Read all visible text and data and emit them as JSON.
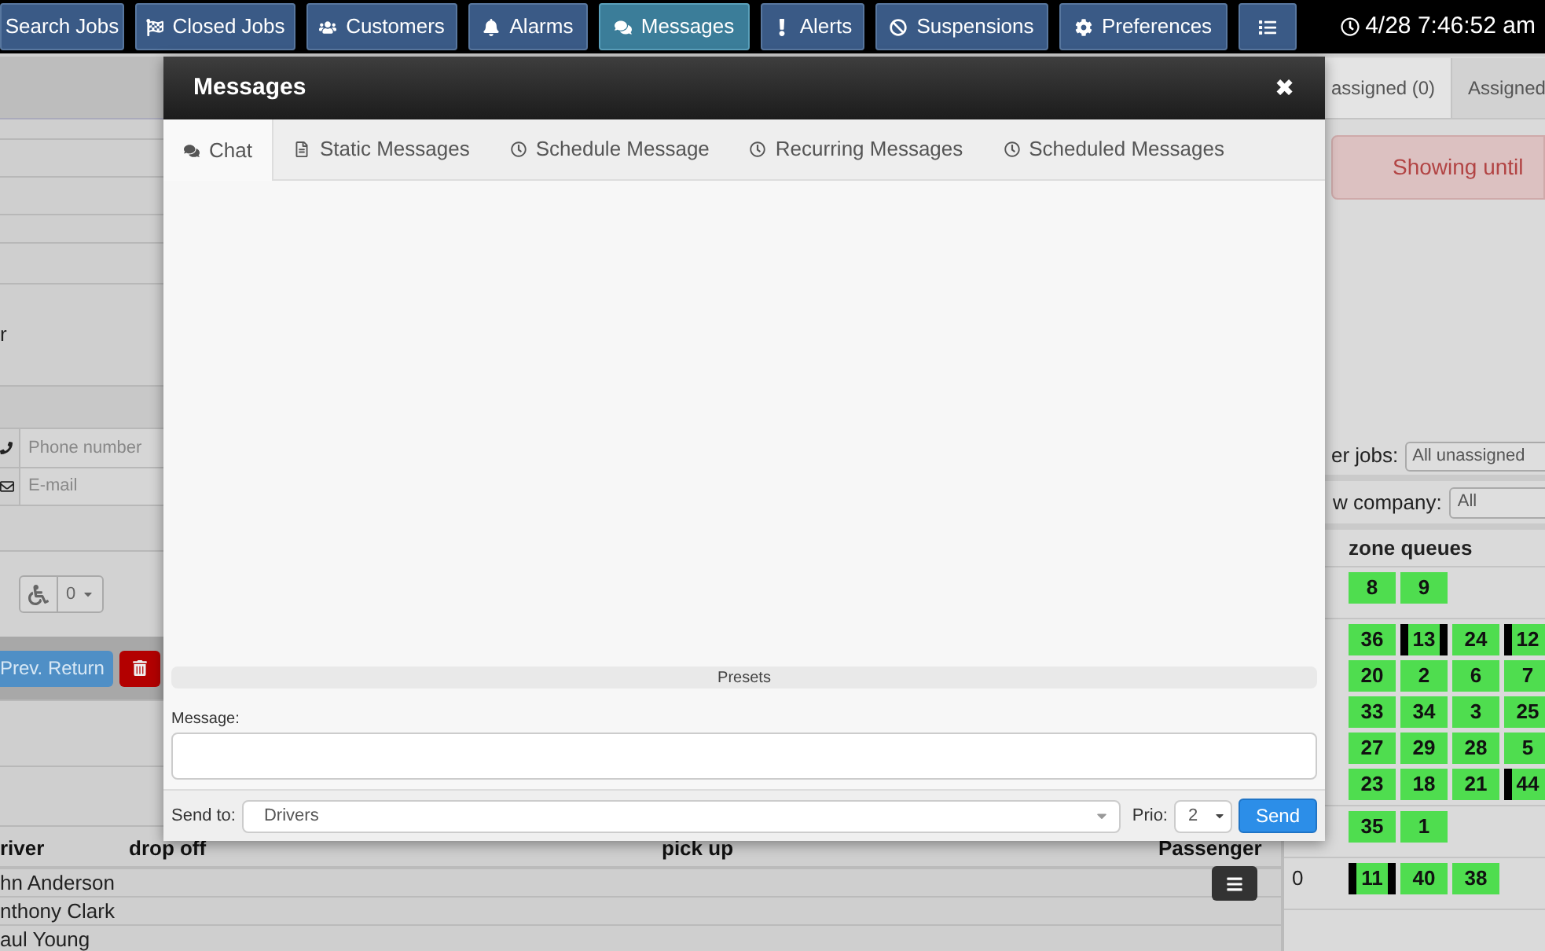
{
  "nav": [
    {
      "label": "Search Jobs",
      "selected": false
    },
    {
      "label": "Closed Jobs",
      "selected": false
    },
    {
      "label": "Customers",
      "selected": false
    },
    {
      "label": "Alarms",
      "selected": false
    },
    {
      "label": "Messages",
      "selected": true
    },
    {
      "label": "Alerts",
      "selected": false
    },
    {
      "label": "Suspensions",
      "selected": false
    },
    {
      "label": "Preferences",
      "selected": false
    },
    {
      "selected": false
    }
  ],
  "clock": "4/28 7:46:52 am",
  "left": {
    "visible_text": "r",
    "phone_placeholder": "Phone number",
    "email_placeholder": "E-mail",
    "wheelchair_value": "0",
    "prev_return": "Prev. Return",
    "table": {
      "columns": [
        "river",
        "drop off",
        "pick up",
        "Passenger"
      ],
      "rows": [
        "hn Anderson",
        "nthony Clark",
        "aul Young"
      ]
    }
  },
  "right": {
    "tabs": [
      {
        "label": "assigned (0)",
        "selected": true
      },
      {
        "label": "Assigned",
        "selected": false
      }
    ],
    "alert": "Showing until",
    "filter_label": "er jobs:",
    "filter_value": "All unassigned",
    "company_label": "w company:",
    "company_value": "All",
    "zone_header": "zone queues",
    "zone_rows": [
      {
        "zones": [
          {
            "n": "8",
            "bar_left": false,
            "bar_right": false
          },
          {
            "n": "9",
            "bar_left": false,
            "bar_right": false
          }
        ]
      },
      {
        "zones": [
          {
            "n": "36",
            "bar_left": false,
            "bar_right": false
          },
          {
            "n": "13",
            "bar_left": true,
            "bar_right": true
          },
          {
            "n": "24",
            "bar_left": false,
            "bar_right": false
          },
          {
            "n": "12",
            "bar_left": true
          }
        ]
      },
      {
        "zones": [
          {
            "n": "20",
            "bar_left": false,
            "bar_right": false
          },
          {
            "n": "2",
            "bar_left": false,
            "bar_right": false
          },
          {
            "n": "6",
            "bar_left": false,
            "bar_right": false
          },
          {
            "n": "7",
            "bar_left": false
          }
        ]
      },
      {
        "zones": [
          {
            "n": "33",
            "bar_left": false,
            "bar_right": false
          },
          {
            "n": "34",
            "bar_left": false,
            "bar_right": false
          },
          {
            "n": "3",
            "bar_left": false,
            "bar_right": false
          },
          {
            "n": "25",
            "bar_left": false
          }
        ]
      },
      {
        "zones": [
          {
            "n": "27",
            "bar_left": false,
            "bar_right": false
          },
          {
            "n": "29",
            "bar_left": false,
            "bar_right": false
          },
          {
            "n": "28",
            "bar_left": false,
            "bar_right": false
          },
          {
            "n": "5",
            "bar_left": false
          }
        ]
      },
      {
        "zones": [
          {
            "n": "23",
            "bar_left": false,
            "bar_right": false
          },
          {
            "n": "18",
            "bar_left": false,
            "bar_right": false
          },
          {
            "n": "21",
            "bar_left": false,
            "bar_right": false
          },
          {
            "n": "44",
            "bar_left": true
          }
        ]
      },
      {
        "zones": [
          {
            "n": "35",
            "bar_left": false,
            "bar_right": false
          },
          {
            "n": "1",
            "bar_left": false,
            "bar_right": false
          }
        ]
      },
      {
        "label": "0",
        "zones": [
          {
            "n": "11",
            "bar_left": true,
            "bar_right": true
          },
          {
            "n": "40",
            "bar_left": false,
            "bar_right": false
          },
          {
            "n": "38",
            "bar_left": false,
            "bar_right": false
          }
        ]
      }
    ]
  },
  "modal": {
    "title": "Messages",
    "close": "✖",
    "tabs": [
      {
        "label": "Chat",
        "selected": true
      },
      {
        "label": "Static Messages",
        "selected": false
      },
      {
        "label": "Schedule Message",
        "selected": false
      },
      {
        "label": "Recurring Messages",
        "selected": false
      },
      {
        "label": "Scheduled Messages",
        "selected": false
      }
    ],
    "presets": "Presets",
    "message_label": "Message:",
    "send_to_label": "Send to:",
    "send_to_value": "Drivers",
    "prio_label": "Prio:",
    "prio_value": "2",
    "send": "Send"
  }
}
